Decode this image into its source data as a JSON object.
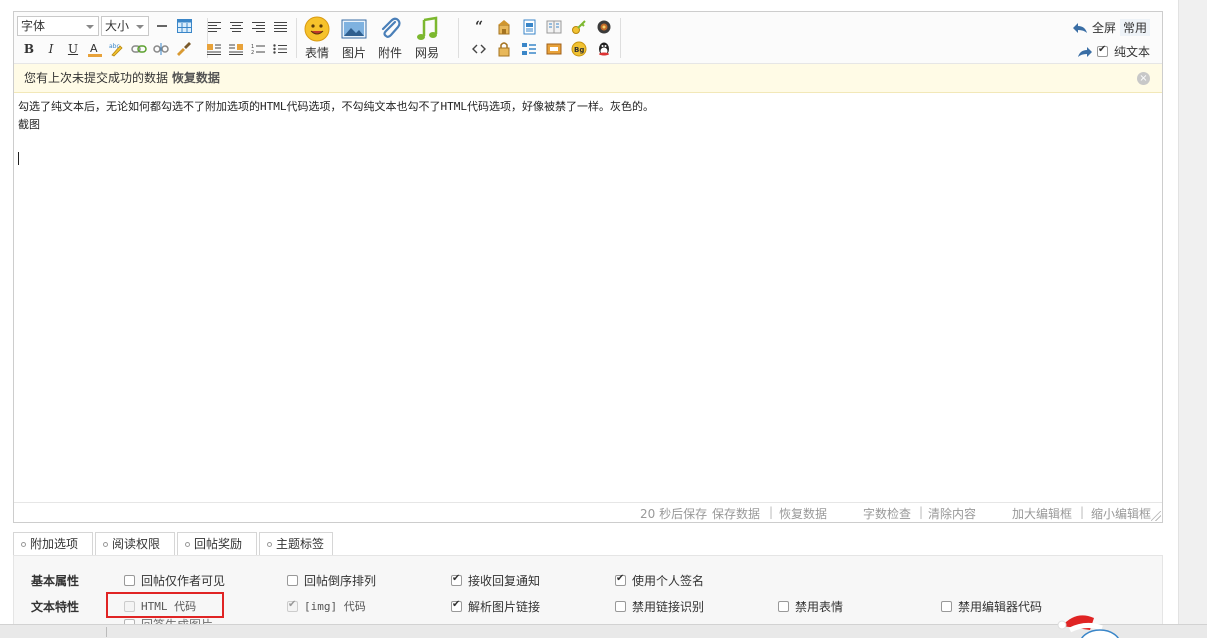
{
  "toolbar": {
    "font_select": "字体",
    "size_select": "大小",
    "emoji_label": "表情",
    "image_label": "图片",
    "attachment_label": "附件",
    "netease_label": "网易",
    "fullscreen_label": "全屏",
    "common_label": "常用",
    "plaintext_label": "纯文本",
    "plaintext_checked": true
  },
  "restore_bar": {
    "message": "您有上次未提交成功的数据 ",
    "restore_link": "恢复数据"
  },
  "content": {
    "line1": "勾选了纯文本后，无论如何都勾选不了附加选项的HTML代码选项，不勾纯文本也勾不了HTML代码选项，好像被禁了一样。灰色的。",
    "line2": "截图"
  },
  "statusbar": {
    "autosave": "20 秒后保存",
    "save_data": "保存数据",
    "restore_data": "恢复数据",
    "word_check": "字数检查",
    "clear_content": "清除内容",
    "enlarge": "加大编辑框",
    "shrink": "缩小编辑框",
    "pipe": "|"
  },
  "tabs": [
    {
      "label": "附加选项",
      "active": true
    },
    {
      "label": "阅读权限",
      "active": false
    },
    {
      "label": "回帖奖励",
      "active": false
    },
    {
      "label": "主题标签",
      "active": false
    }
  ],
  "options": {
    "basic_label": "基本属性",
    "text_label": "文本特性",
    "basic": [
      {
        "label": "回帖仅作者可见",
        "checked": false
      },
      {
        "label": "回帖倒序排列",
        "checked": false
      },
      {
        "label": "接收回复通知",
        "checked": true
      },
      {
        "label": "使用个人签名",
        "checked": true
      }
    ],
    "text": [
      {
        "label": "HTML 代码",
        "checked": false,
        "disabled": true
      },
      {
        "label": "[img] 代码",
        "checked": true,
        "disabled": true
      },
      {
        "label": "解析图片链接",
        "checked": true
      },
      {
        "label": "禁用链接识别",
        "checked": false
      },
      {
        "label": "禁用表情",
        "checked": false
      },
      {
        "label": "禁用编辑器代码",
        "checked": false
      }
    ],
    "partial_row": "回签生成图片"
  },
  "colors": {
    "highlight": "#e02424",
    "restore_bg": "#fffbe6"
  }
}
